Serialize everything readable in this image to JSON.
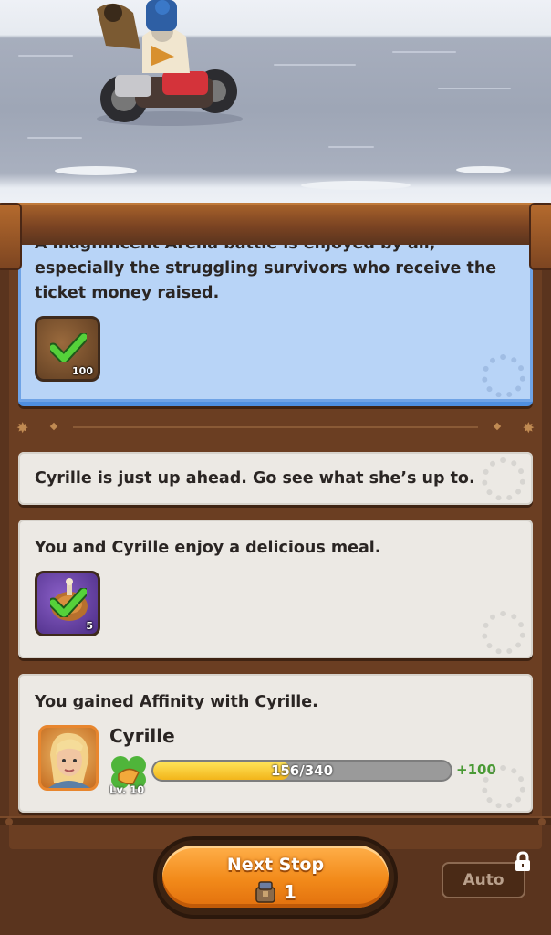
{
  "story_cards": [
    {
      "text": "A magnificent Arena battle is enjoyed by all, especially the struggling survivors who receive the ticket money raised.",
      "reward": {
        "icon": "book-reward-icon",
        "count": "100",
        "claimed": true
      }
    },
    {
      "text": "Cyrille is just up ahead. Go see what she’s up to."
    },
    {
      "text": "You and Cyrille enjoy a delicious meal.",
      "reward": {
        "icon": "meal-reward-icon",
        "count": "5",
        "claimed": true
      }
    },
    {
      "text": "You gained Affinity with Cyrille.",
      "character": {
        "name": "Cyrille",
        "level": "Lv. 10",
        "affinity_progress": "156/340",
        "affinity_fraction": 0.459,
        "affinity_gain": "+100"
      }
    }
  ],
  "next_stop": {
    "label": "Next Stop",
    "cost": "1",
    "cost_icon": "supply-crate-icon"
  },
  "auto": {
    "label": "Auto",
    "locked": true
  },
  "colors": {
    "accent": "#f28a1a",
    "active_card": "#b8d4f7",
    "panel": "#5a341e",
    "gain": "#4a9a35"
  }
}
